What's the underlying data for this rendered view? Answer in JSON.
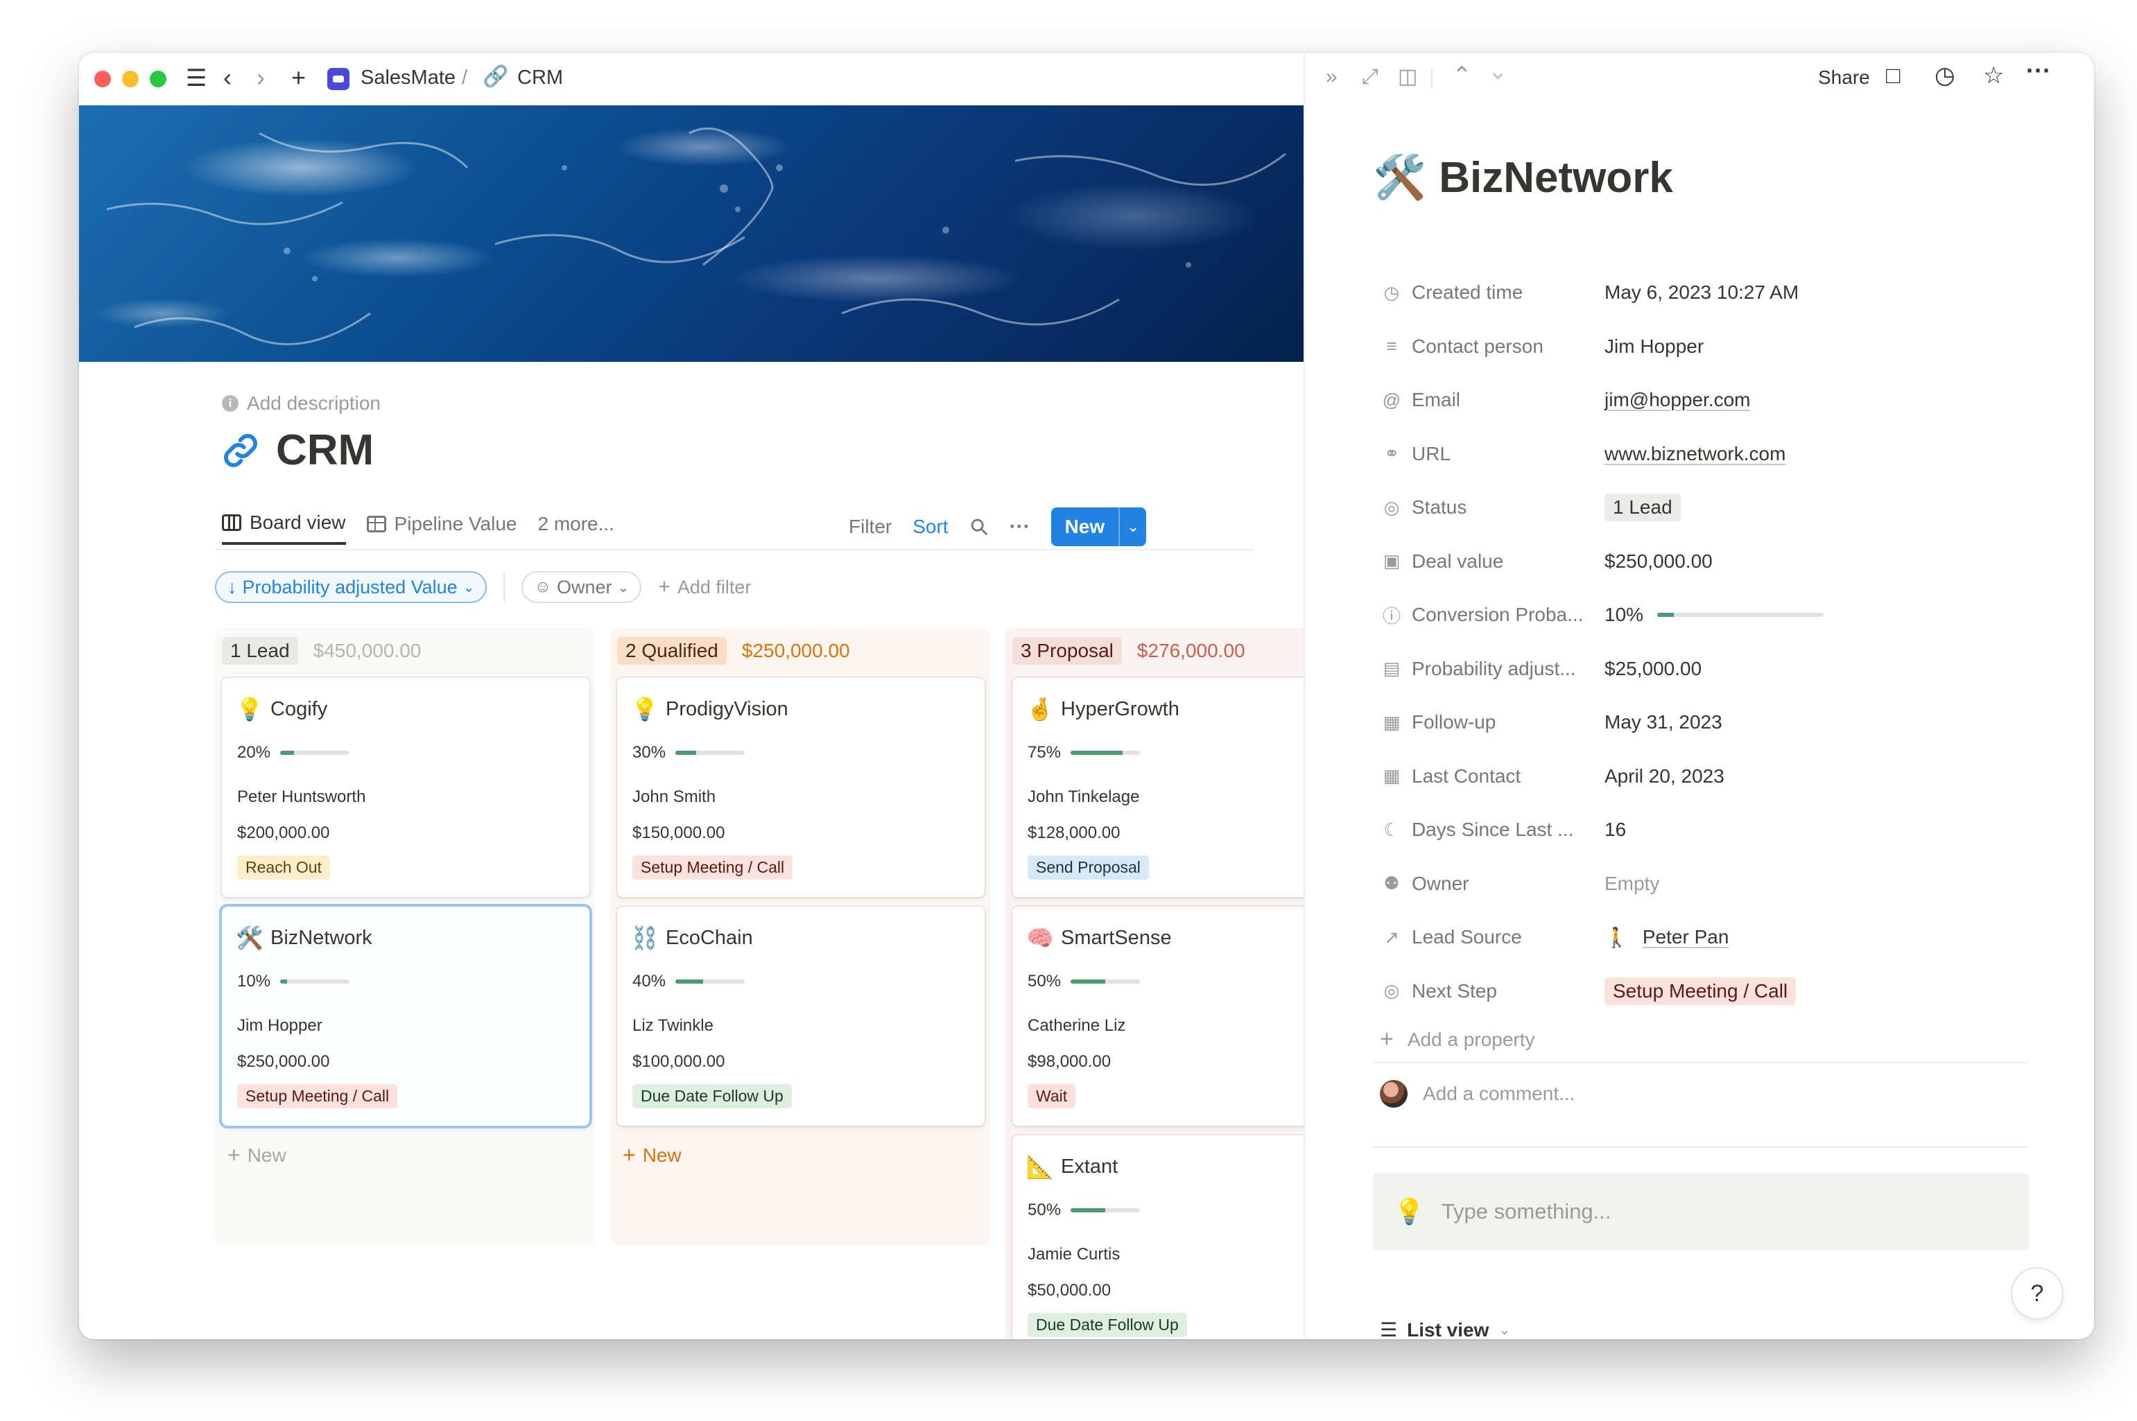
{
  "topbar": {
    "workspace": "SalesMate",
    "separator": "/",
    "page": "CRM",
    "icons": [
      "menu-icon",
      "back-icon",
      "forward-icon",
      "plus-icon",
      "link-icon"
    ]
  },
  "page": {
    "add_description": "Add description",
    "title": "CRM"
  },
  "views": {
    "tabs": [
      {
        "label": "Board view",
        "icon": "board-icon",
        "active": true
      },
      {
        "label": "Pipeline Value",
        "icon": "table-icon",
        "active": false
      }
    ],
    "more": "2 more...",
    "filter": "Filter",
    "sort": "Sort",
    "more_icon": "···",
    "new_button": "New"
  },
  "filters": {
    "sort_pill": "Probability adjusted Value",
    "owner_pill": "Owner",
    "add_filter": "Add filter"
  },
  "board": {
    "columns": [
      {
        "label": "1 Lead",
        "total": "$450,000.00",
        "tag_bg": "#e9e9e7",
        "tag_fg": "#37352f",
        "total_color": "#b4b4b0",
        "col_bg": "#f9f9f8",
        "cards": [
          {
            "emoji": "💡",
            "title": "Cogify",
            "prob_label": "20%",
            "prob": 0.2,
            "person": "Peter Huntsworth",
            "value": "$200,000.00",
            "tag": "Reach Out",
            "tag_class": "tag-yellow"
          },
          {
            "emoji": "🛠️",
            "title": "BizNetwork",
            "prob_label": "10%",
            "prob": 0.1,
            "person": "Jim Hopper",
            "value": "$250,000.00",
            "tag": "Setup Meeting / Call",
            "tag_class": "tag-red"
          }
        ],
        "new_label": "New",
        "new_color": "#a7a6a2"
      },
      {
        "label": "2 Qualified",
        "total": "$250,000.00",
        "tag_bg": "#fadcc7",
        "tag_fg": "#49290e",
        "total_color": "#d9730d",
        "col_bg": "#fcf5f0",
        "cards": [
          {
            "emoji": "💡",
            "title": "ProdigyVision",
            "prob_label": "30%",
            "prob": 0.3,
            "person": "John Smith",
            "value": "$150,000.00",
            "tag": "Setup Meeting / Call",
            "tag_class": "tag-red"
          },
          {
            "emoji": "⛓️",
            "title": "EcoChain",
            "prob_label": "40%",
            "prob": 0.4,
            "person": "Liz Twinkle",
            "value": "$100,000.00",
            "tag": "Due Date Follow Up",
            "tag_class": "tag-green"
          }
        ],
        "new_label": "New",
        "new_color": "#d9730d"
      },
      {
        "label": "3 Proposal",
        "total": "$276,000.00",
        "tag_bg": "#f4dfd8",
        "tag_fg": "#5d1715",
        "total_color": "#cd5d4a",
        "col_bg": "#fbf3f1",
        "cards": [
          {
            "emoji": "🤞",
            "title": "HyperGrowth",
            "prob_label": "75%",
            "prob": 0.75,
            "person": "John Tinkelage",
            "value": "$128,000.00",
            "tag": "Send Proposal",
            "tag_class": "tag-blue"
          },
          {
            "emoji": "🧠",
            "title": "SmartSense",
            "prob_label": "50%",
            "prob": 0.5,
            "person": "Catherine Liz",
            "value": "$98,000.00",
            "tag": "Wait",
            "tag_class": "tag-pink"
          },
          {
            "emoji": "📐",
            "title": "Extant",
            "prob_label": "50%",
            "prob": 0.5,
            "person": "Jamie Curtis",
            "value": "$50,000.00",
            "tag": "Due Date Follow Up",
            "tag_class": "tag-green"
          }
        ]
      }
    ]
  },
  "detail": {
    "share": "Share",
    "emoji": "🛠️",
    "title": "BizNetwork",
    "properties": [
      {
        "icon": "◷",
        "icon_name": "clock-icon",
        "name": "Created time",
        "value": "May 6, 2023 10:27 AM",
        "kind": "text"
      },
      {
        "icon": "≡",
        "icon_name": "text-icon",
        "name": "Contact person",
        "value": "Jim Hopper",
        "kind": "text"
      },
      {
        "icon": "@",
        "icon_name": "email-icon",
        "name": "Email",
        "value": "jim@hopper.com",
        "kind": "link"
      },
      {
        "icon": "⚭",
        "icon_name": "url-icon",
        "name": "URL",
        "value": "www.biznetwork.com",
        "kind": "link"
      },
      {
        "icon": "◎",
        "icon_name": "status-icon",
        "name": "Status",
        "value": "1 Lead",
        "kind": "status"
      },
      {
        "icon": "▣",
        "icon_name": "money-icon",
        "name": "Deal value",
        "value": "$250,000.00",
        "kind": "text"
      },
      {
        "icon": "ⓘ",
        "icon_name": "formula-icon",
        "name": "Conversion Proba...",
        "value": "10%",
        "kind": "progress",
        "fraction": 0.1
      },
      {
        "icon": "▤",
        "icon_name": "money-icon",
        "name": "Probability adjust...",
        "value": "$25,000.00",
        "kind": "text"
      },
      {
        "icon": "▦",
        "icon_name": "calendar-icon",
        "name": "Follow-up",
        "value": "May 31, 2023",
        "kind": "text"
      },
      {
        "icon": "▦",
        "icon_name": "calendar-icon",
        "name": "Last Contact",
        "value": "April 20, 2023",
        "kind": "text"
      },
      {
        "icon": "☾",
        "icon_name": "moon-icon",
        "name": "Days Since Last ...",
        "value": "16",
        "kind": "text"
      },
      {
        "icon": "⚉",
        "icon_name": "people-icon",
        "name": "Owner",
        "value": "Empty",
        "kind": "empty"
      },
      {
        "icon": "↗",
        "icon_name": "arrow-icon",
        "name": "Lead Source",
        "value": "Peter Pan",
        "kind": "source"
      },
      {
        "icon": "◎",
        "icon_name": "status-icon",
        "name": "Next Step",
        "value": "Setup Meeting / Call",
        "kind": "step"
      }
    ],
    "add_property": "Add a property",
    "comment_placeholder": "Add a comment...",
    "type_placeholder": "Type something...",
    "help": "?",
    "list_view": "List view"
  }
}
